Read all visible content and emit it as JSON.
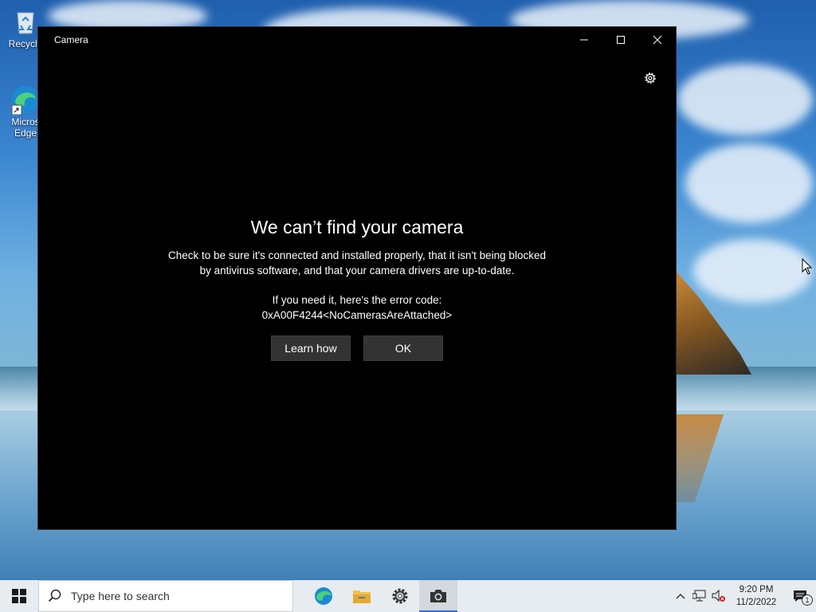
{
  "desktop": {
    "icons": [
      {
        "label": "Recycle",
        "icon": "recycle-bin-icon"
      },
      {
        "label": "Micros Edge",
        "icon": "edge-icon"
      }
    ]
  },
  "window": {
    "title": "Camera",
    "minimize_icon": "minimize-icon",
    "maximize_icon": "maximize-icon",
    "close_icon": "close-icon",
    "settings_icon": "gear-icon",
    "heading": "We can’t find your camera",
    "message_line1": "Check to be sure it's connected and installed properly, that it isn't being blocked",
    "message_line2": "by antivirus software, and that your camera drivers are up-to-date.",
    "error_intro": "If you need it, here's the error code:",
    "error_code": "0xA00F4244<NoCamerasAreAttached>",
    "learn_how_label": "Learn how",
    "ok_label": "OK"
  },
  "taskbar": {
    "search_placeholder": "Type here to search",
    "apps": [
      {
        "name": "edge-icon"
      },
      {
        "name": "file-explorer-icon"
      },
      {
        "name": "settings-icon"
      },
      {
        "name": "camera-icon",
        "active": true
      }
    ],
    "clock_time": "9:20 PM",
    "clock_date": "11/2/2022",
    "notification_count": "1"
  },
  "colors": {
    "window_bg": "#000000",
    "button_bg": "#333333",
    "taskbar_bg": "#e7ecf1",
    "active_indicator": "#2f6fd1"
  }
}
